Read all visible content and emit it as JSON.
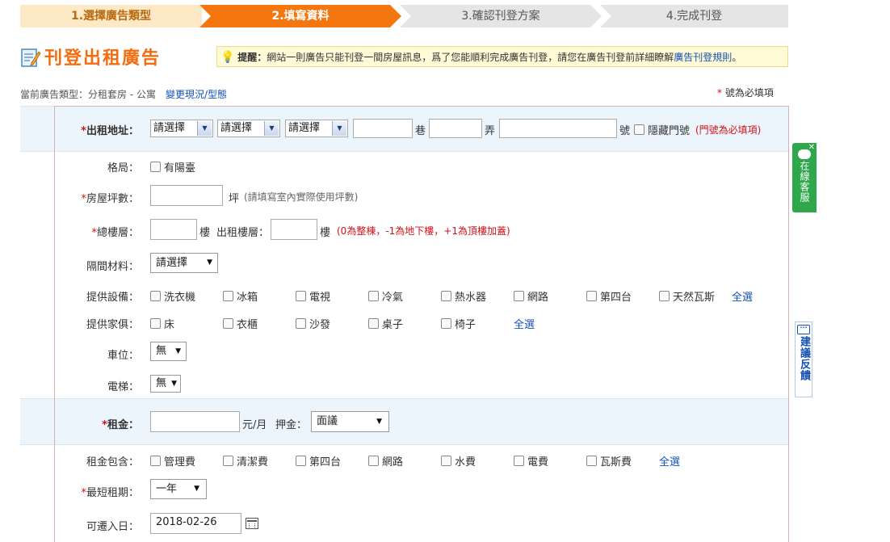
{
  "steps": [
    "1.選擇廣告類型",
    "2.填寫資料",
    "3.確認刊登方案",
    "4.完成刊登"
  ],
  "page_title": "刊登出租廣告",
  "notice": {
    "label": "提醒：",
    "text": "網站一則廣告只能刊登一間房屋訊息，爲了您能順利完成廣告刊登，請您在廣告刊登前詳細瞭解",
    "link": "廣告刊登規則",
    "end": "。"
  },
  "current_type": {
    "text": "當前廣告類型：分租套房 - 公寓",
    "change_link": "變更現況/型態"
  },
  "required_note": "號為必填項",
  "address": {
    "label": "出租地址：",
    "selects": [
      "請選擇",
      "請選擇",
      "請選擇"
    ],
    "lane": "巷",
    "alley": "弄",
    "number": "號",
    "hide_label": "隱藏門號",
    "hint": "(門號為必填項)"
  },
  "layout": {
    "label": "格局：",
    "balcony": "有陽臺"
  },
  "area": {
    "label": "房屋坪數：",
    "unit": "坪",
    "hint": "(請填寫室內實際使用坪數)"
  },
  "floors": {
    "label": "總樓層：",
    "unit": "樓",
    "rent_floor_label": "出租樓層：",
    "unit2": "樓",
    "hint": "(0為整棟，-1為地下樓，+1為頂樓加蓋)"
  },
  "partition": {
    "label": "隔間材料：",
    "value": "請選擇"
  },
  "equipment": {
    "label": "提供設備：",
    "items": [
      "洗衣機",
      "冰箱",
      "電視",
      "冷氣",
      "熱水器",
      "網路",
      "第四台",
      "天然瓦斯"
    ],
    "select_all": "全選"
  },
  "furniture": {
    "label": "提供家俱：",
    "items": [
      "床",
      "衣櫃",
      "沙發",
      "桌子",
      "椅子"
    ],
    "select_all": "全選"
  },
  "parking": {
    "label": "車位：",
    "value": "無"
  },
  "elevator": {
    "label": "電梯：",
    "value": "無"
  },
  "rent": {
    "label": "租金：",
    "unit": "元/月",
    "deposit_label": "押金：",
    "deposit_value": "面議"
  },
  "rent_includes": {
    "label": "租金包含：",
    "items": [
      "管理費",
      "清潔費",
      "第四台",
      "網路",
      "水費",
      "電費",
      "瓦斯費"
    ],
    "select_all": "全選"
  },
  "min_lease": {
    "label": "最短租期：",
    "value": "一年"
  },
  "move_in": {
    "label": "可遷入日：",
    "value": "2018-02-26"
  },
  "side": {
    "chat": "在線客服",
    "feedback": "建議反饋"
  },
  "colors": {
    "accent": "#f4760e",
    "required": "#d0131a",
    "link": "#1450b4",
    "band": "#ecf5fc"
  }
}
